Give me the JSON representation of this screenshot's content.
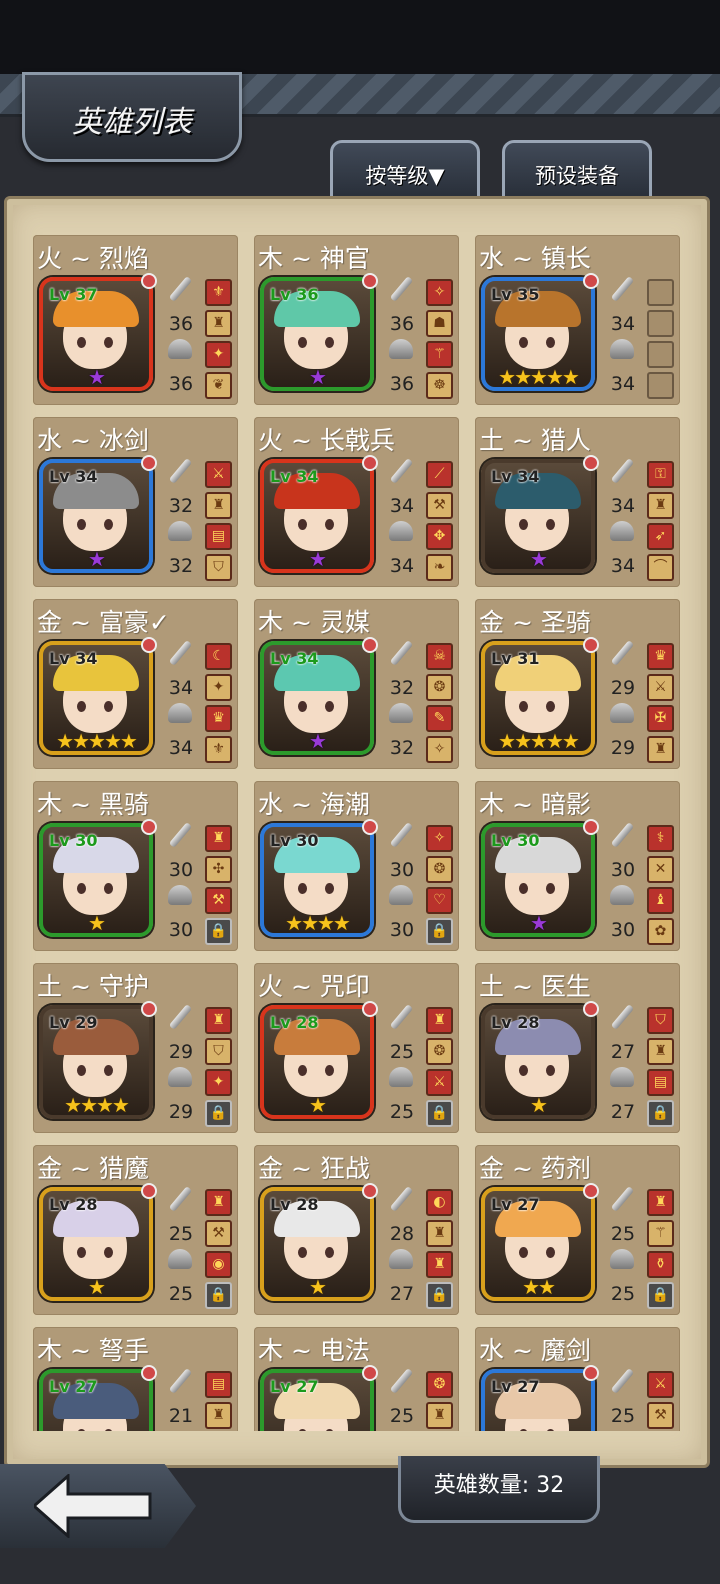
{
  "title": "英雄列表",
  "buttons": {
    "sort": "按等级▼",
    "preset": "预设装备"
  },
  "hero_count_label": "英雄数量: 32",
  "heroes": [
    {
      "name": "火 ~ 烈焰",
      "lv": "Lv 37",
      "atk": "36",
      "def": "36",
      "frame": "red",
      "hair": "#e8902c",
      "stars": "★",
      "star_color": "purple",
      "equip": [
        "⚜",
        "♜",
        "✦",
        "❦"
      ]
    },
    {
      "name": "木 ~ 神官",
      "lv": "Lv 36",
      "atk": "36",
      "def": "36",
      "frame": "green",
      "hair": "#5fc8a8",
      "stars": "★",
      "star_color": "purple",
      "equip": [
        "✧",
        "☗",
        "⚚",
        "☸"
      ]
    },
    {
      "name": "水 ~ 镇长",
      "lv": "Lv 35",
      "atk": "34",
      "def": "34",
      "frame": "blue",
      "hair": "#b8742c",
      "stars": "★★★★★",
      "star_color": "gold",
      "equip": [
        "",
        "",
        "",
        ""
      ]
    },
    {
      "name": "水 ~ 冰剑",
      "lv": "Lv 34",
      "atk": "32",
      "def": "32",
      "frame": "blue",
      "hair": "#8c8c8c",
      "stars": "★",
      "star_color": "purple",
      "equip": [
        "⚔",
        "♜",
        "▤",
        "⛉"
      ]
    },
    {
      "name": "火 ~ 长戟兵",
      "lv": "Lv 34",
      "atk": "34",
      "def": "34",
      "frame": "red",
      "hair": "#c8341c",
      "stars": "★",
      "star_color": "purple",
      "equip": [
        "⟋",
        "⚒",
        "✥",
        "❧"
      ]
    },
    {
      "name": "土 ~ 猎人",
      "lv": "Lv 34",
      "atk": "34",
      "def": "34",
      "frame": "dark",
      "hair": "#2c5c6c",
      "stars": "★",
      "star_color": "purple",
      "equip": [
        "⚿",
        "♜",
        "➶",
        "⌒"
      ]
    },
    {
      "name": "金 ~ 富豪✓",
      "lv": "Lv 34",
      "atk": "34",
      "def": "34",
      "frame": "gold",
      "hair": "#e8c43c",
      "stars": "★★★★★",
      "star_color": "gold",
      "equip": [
        "☾",
        "✦",
        "♛",
        "⚜"
      ]
    },
    {
      "name": "木 ~ 灵媒",
      "lv": "Lv 34",
      "atk": "32",
      "def": "32",
      "frame": "green",
      "hair": "#5cc8b0",
      "stars": "★",
      "star_color": "purple",
      "equip": [
        "☠",
        "❂",
        "✎",
        "✧"
      ]
    },
    {
      "name": "金 ~ 圣骑",
      "lv": "Lv 31",
      "atk": "29",
      "def": "29",
      "frame": "gold",
      "hair": "#f0d078",
      "stars": "★★★★★",
      "star_color": "gold",
      "equip": [
        "♛",
        "⚔",
        "✠",
        "♜"
      ]
    },
    {
      "name": "木 ~ 黑骑",
      "lv": "Lv 30",
      "atk": "30",
      "def": "30",
      "frame": "green",
      "hair": "#d8d8e8",
      "stars": "★",
      "star_color": "gold",
      "equip": [
        "♜",
        "✣",
        "⚒",
        "🔒"
      ]
    },
    {
      "name": "水 ~ 海潮",
      "lv": "Lv 30",
      "atk": "30",
      "def": "30",
      "frame": "blue",
      "hair": "#7ad8d0",
      "stars": "★★★★",
      "star_color": "gold",
      "equip": [
        "✧",
        "❂",
        "♡",
        "🔒"
      ]
    },
    {
      "name": "木 ~ 暗影",
      "lv": "Lv 30",
      "atk": "30",
      "def": "30",
      "frame": "green",
      "hair": "#d8d8d8",
      "stars": "★",
      "star_color": "purple",
      "equip": [
        "⚕",
        "✕",
        "♝",
        "✿"
      ]
    },
    {
      "name": "土 ~ 守护",
      "lv": "Lv 29",
      "atk": "29",
      "def": "29",
      "frame": "dark",
      "hair": "#9a5c3c",
      "stars": "★★★★",
      "star_color": "gold",
      "equip": [
        "♜",
        "⛉",
        "✦",
        "🔒"
      ]
    },
    {
      "name": "火 ~ 咒印",
      "lv": "Lv 28",
      "atk": "25",
      "def": "25",
      "frame": "red",
      "hair": "#c87c3c",
      "stars": "★",
      "star_color": "gold",
      "equip": [
        "♜",
        "❂",
        "⚔",
        "🔒"
      ]
    },
    {
      "name": "土 ~ 医生",
      "lv": "Lv 28",
      "atk": "27",
      "def": "27",
      "frame": "dark",
      "hair": "#8c8cb0",
      "stars": "★",
      "star_color": "gold",
      "equip": [
        "⛉",
        "♜",
        "▤",
        "🔒"
      ]
    },
    {
      "name": "金 ~ 猎魔",
      "lv": "Lv 28",
      "atk": "25",
      "def": "25",
      "frame": "gold",
      "hair": "#d8d0e8",
      "stars": "★",
      "star_color": "gold",
      "equip": [
        "♜",
        "⚒",
        "◉",
        "🔒"
      ]
    },
    {
      "name": "金 ~ 狂战",
      "lv": "Lv 28",
      "atk": "28",
      "def": "27",
      "frame": "gold",
      "hair": "#e8e8e8",
      "stars": "★",
      "star_color": "gold",
      "equip": [
        "◐",
        "♜",
        "♜",
        "🔒"
      ]
    },
    {
      "name": "金 ~ 药剂",
      "lv": "Lv 27",
      "atk": "25",
      "def": "25",
      "frame": "gold",
      "hair": "#f0a850",
      "stars": "★★",
      "star_color": "gold",
      "equip": [
        "♜",
        "⚚",
        "⚱",
        "🔒"
      ]
    },
    {
      "name": "木 ~ 弩手",
      "lv": "Lv 27",
      "atk": "21",
      "def": "",
      "frame": "green",
      "hair": "#4a5c7c",
      "stars": "",
      "star_color": "gold",
      "equip": [
        "▤",
        "♜",
        "",
        ""
      ]
    },
    {
      "name": "木 ~ 电法",
      "lv": "Lv 27",
      "atk": "25",
      "def": "",
      "frame": "green",
      "hair": "#f0d8b0",
      "stars": "",
      "star_color": "gold",
      "equip": [
        "❂",
        "♜",
        "",
        ""
      ]
    },
    {
      "name": "水 ~ 魔剑",
      "lv": "Lv 27",
      "atk": "25",
      "def": "",
      "frame": "blue",
      "hair": "#e8c8a8",
      "stars": "",
      "star_color": "gold",
      "equip": [
        "⚔",
        "⚒",
        "",
        ""
      ]
    }
  ],
  "colors": {
    "frame_red": "#d8341c",
    "frame_green": "#2c9a2c",
    "frame_blue": "#2c78d8",
    "frame_gold": "#d8a01c",
    "frame_dark": "#4a3a2c"
  }
}
